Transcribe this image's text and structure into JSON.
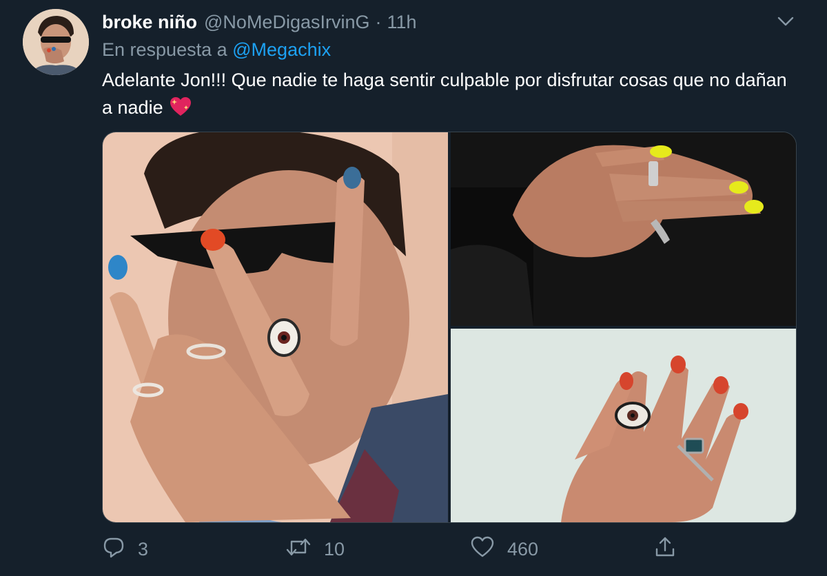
{
  "tweet": {
    "display_name": "broke niño",
    "handle": "@NoMeDigasIrvinG",
    "separator": "·",
    "time": "11h",
    "reply_prefix": "En respuesta a",
    "reply_mention": "@Megachix",
    "text": "Adelante Jon!!! Que nadie te haga sentir culpable por disfrutar cosas que no dañan a nadie",
    "emoji": "sparkling-heart-emoji"
  },
  "media": {
    "photos": [
      {
        "name": "person-with-sunglasses-painted-nails"
      },
      {
        "name": "hand-yellow-nails-rings"
      },
      {
        "name": "hand-red-nails-eye-ring"
      }
    ]
  },
  "actions": {
    "reply_count": "3",
    "retweet_count": "10",
    "like_count": "460"
  },
  "icons": {
    "reply": "reply-icon",
    "retweet": "retweet-icon",
    "like": "heart-icon",
    "share": "share-icon",
    "caret": "chevron-down-icon"
  },
  "colors": {
    "background": "#15202b",
    "secondary_text": "#8899a6",
    "link": "#1da1f2",
    "border": "#38444d"
  }
}
